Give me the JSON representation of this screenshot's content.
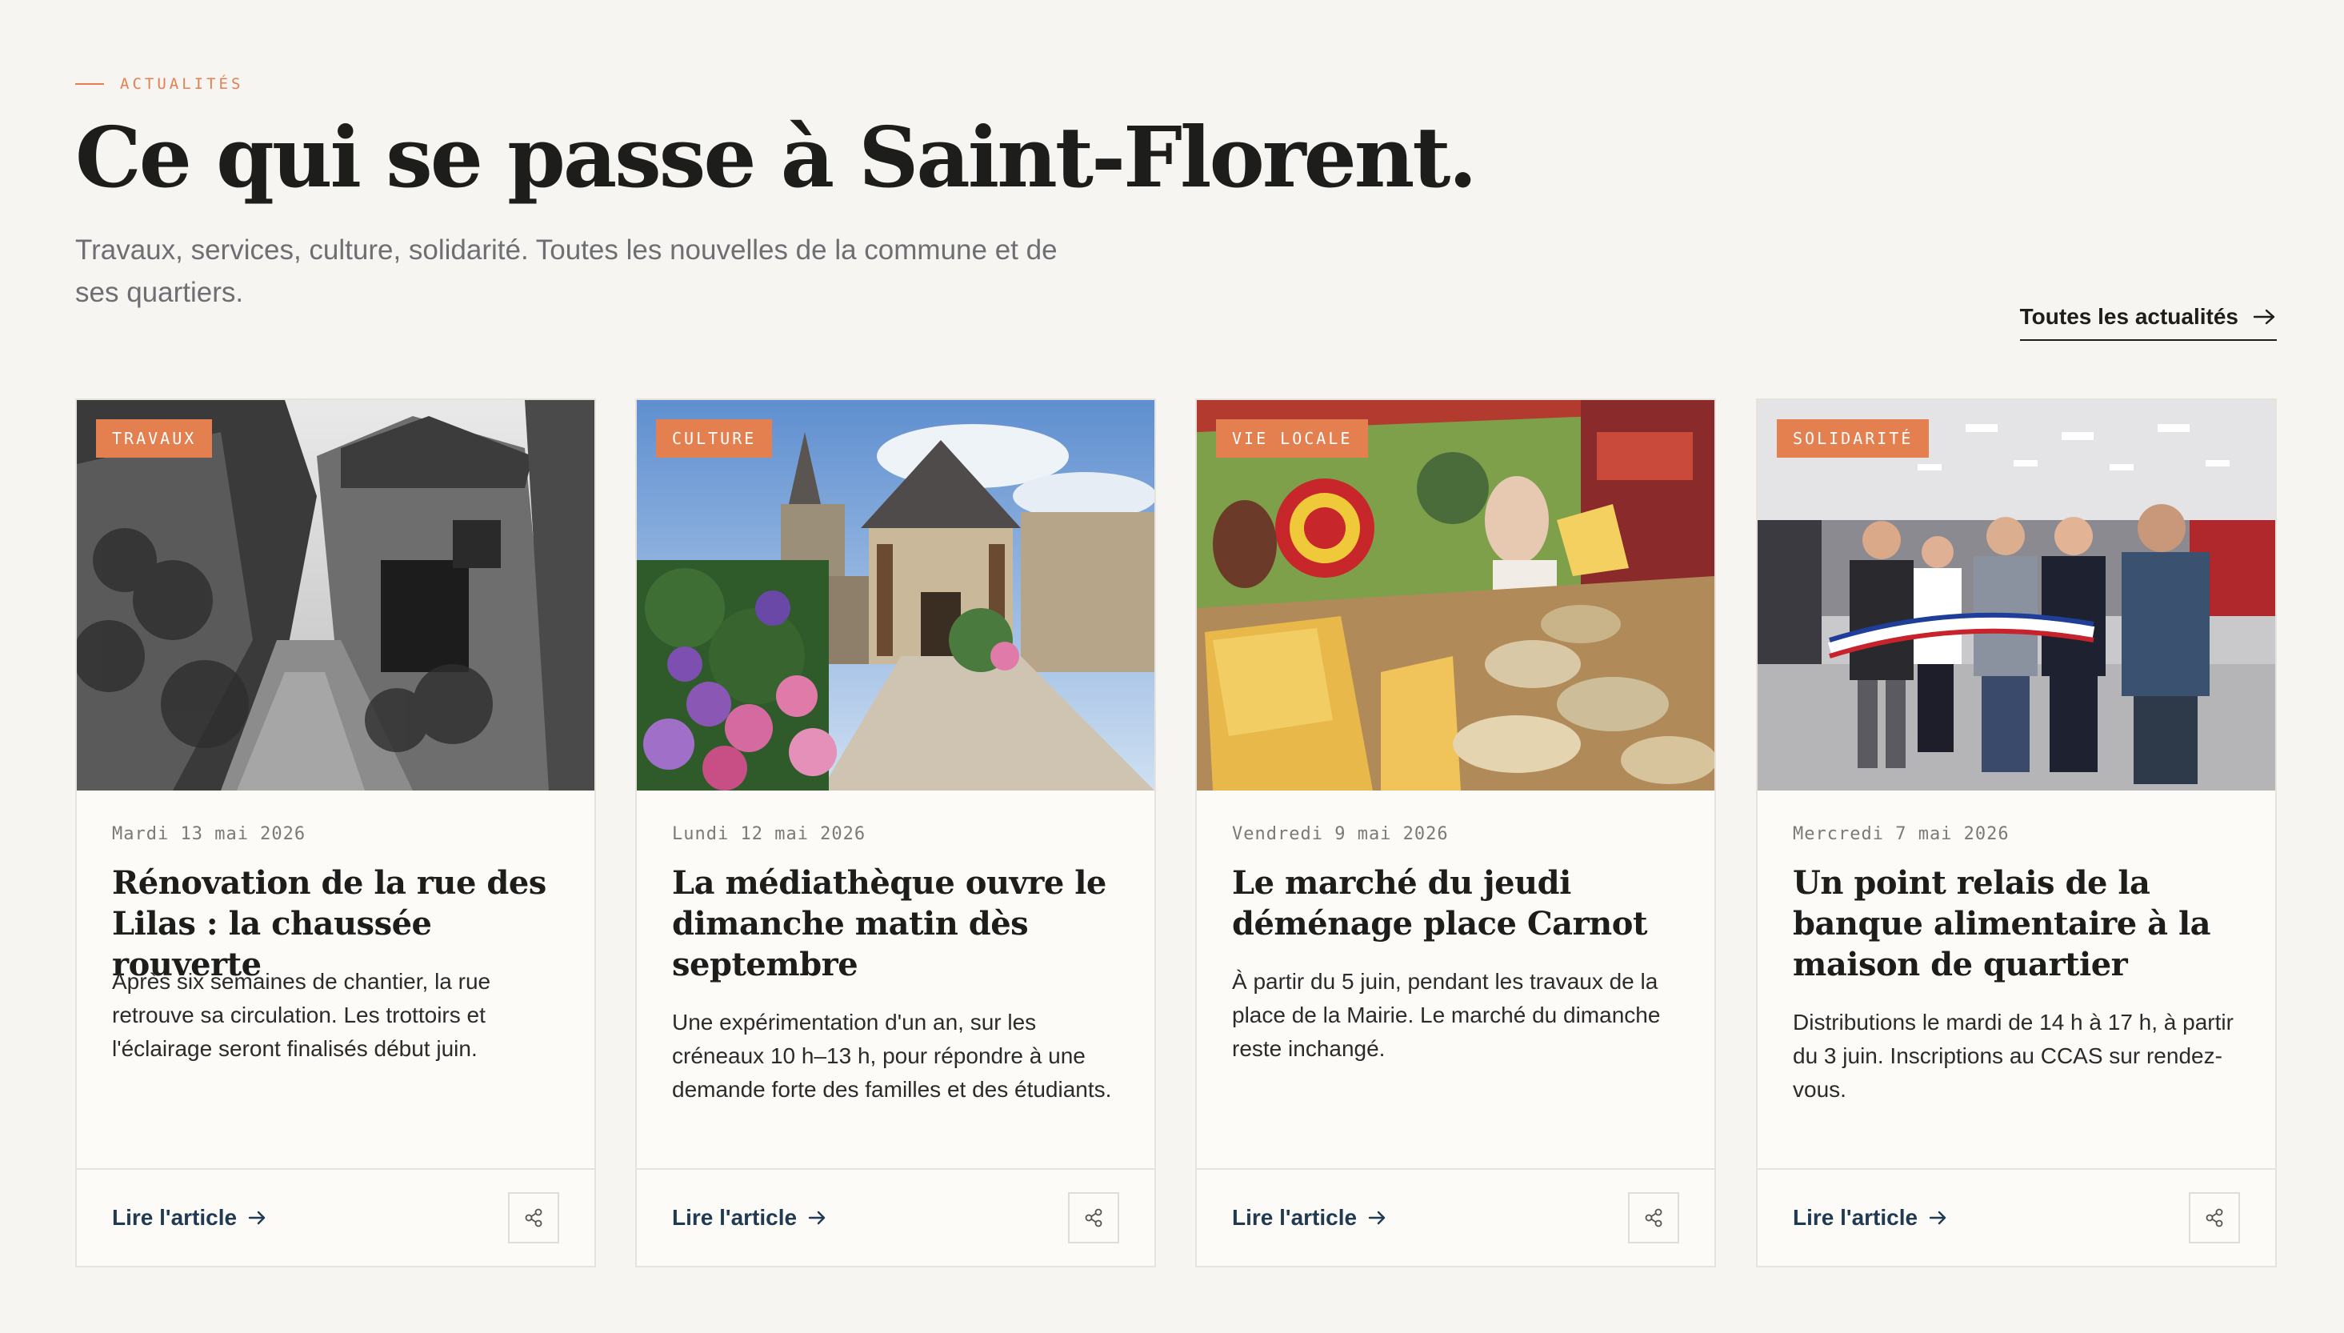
{
  "header": {
    "eyebrow": "Actualités",
    "title": "Ce qui se passe à Saint-Florent.",
    "subtitle": "Travaux, services, culture, solidarité. Toutes les nouvelles de la commune et de ses quartiers.",
    "all_link": "Toutes les actualités"
  },
  "colors": {
    "accent": "#e47f4f",
    "background": "#f6f5f1",
    "link": "#1f3a52"
  },
  "icons": {
    "arrow": "arrow-right-icon",
    "share": "share-icon"
  },
  "cards": [
    {
      "tag": "TRAVAUX",
      "date": "Mardi 13 mai 2026",
      "headline": "Rénovation de la rue des Lilas : la chaussée rouverte",
      "excerpt": "Après six semaines de chantier, la rue retrouve sa circulation. Les trottoirs et l'éclairage seront finalisés début juin.",
      "read_label": "Lire l'article"
    },
    {
      "tag": "CULTURE",
      "date": "Lundi 12 mai 2026",
      "headline": "La médiathèque ouvre le dimanche matin dès septembre",
      "excerpt": "Une expérimentation d'un an, sur les créneaux 10 h–13 h, pour répondre à une demande forte des familles et des étudiants.",
      "read_label": "Lire l'article"
    },
    {
      "tag": "VIE LOCALE",
      "date": "Vendredi 9 mai 2026",
      "headline": "Le marché du jeudi déménage place Carnot",
      "excerpt": "À partir du 5 juin, pendant les travaux de la place de la Mairie. Le marché du dimanche reste inchangé.",
      "read_label": "Lire l'article"
    },
    {
      "tag": "SOLIDARITÉ",
      "date": "Mercredi 7 mai 2026",
      "headline": "Un point relais de la banque alimentaire à la maison de quartier",
      "excerpt": "Distributions le mardi de 14 h à 17 h, à partir du 3 juin. Inscriptions au CCAS sur rendez-vous.",
      "read_label": "Lire l'article"
    }
  ]
}
